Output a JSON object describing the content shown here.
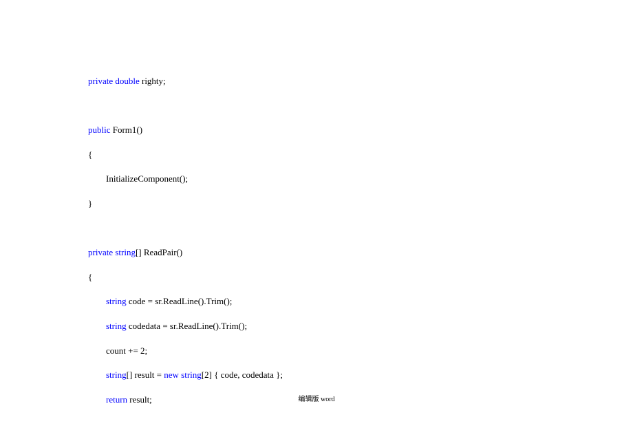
{
  "code": {
    "l1_kw": "private double",
    "l1_rest": " righty;",
    "l2_kw": "public",
    "l2_rest": " Form1()",
    "l3": "{",
    "l4": "InitializeComponent();",
    "l5": "}",
    "l6_kw": "private string",
    "l6_rest": "[] ReadPair()",
    "l7": "{",
    "l8_kw": "string",
    "l8_rest": " code = sr.ReadLine().Trim();",
    "l9_kw": "string",
    "l9_rest": " codedata = sr.ReadLine().Trim();",
    "l10": "count += 2;",
    "l11_kw1": "string",
    "l11_mid": "[] result = ",
    "l11_kw2": "new string",
    "l11_rest": "[2] { code, codedata };",
    "l12_kw": "return",
    "l12_rest": " result;"
  },
  "footer": "编辑版 word"
}
